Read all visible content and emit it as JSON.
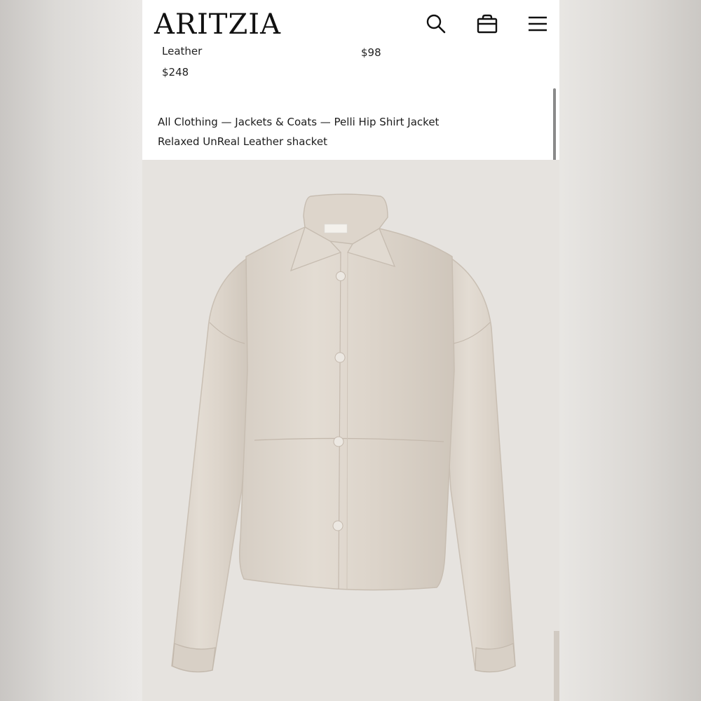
{
  "header": {
    "logo": "ARITZIA",
    "icons": [
      "search-icon",
      "bag-icon",
      "menu-icon"
    ]
  },
  "previous_products": {
    "left": {
      "name": "Leather",
      "price": "$248"
    },
    "right": {
      "price": "$98"
    }
  },
  "breadcrumb": "All Clothing — Jackets & Coats — Pelli Hip Shirt Jacket",
  "product": {
    "subtitle": "Relaxed UnReal Leather shacket",
    "image": "jacket-image"
  },
  "colors": {
    "background": "#e6e3df",
    "jacket": "#ddd5cb",
    "text": "#1c1c1c"
  }
}
